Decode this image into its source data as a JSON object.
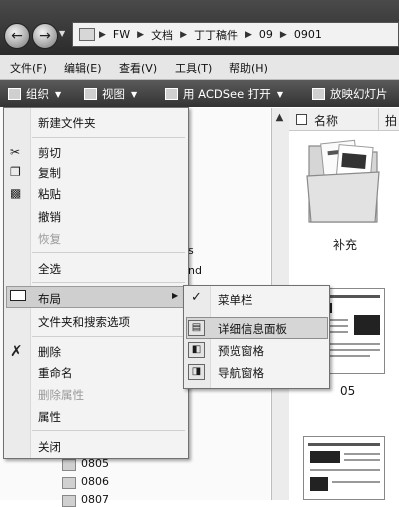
{
  "address": {
    "crumbs": [
      "FW",
      "文档",
      "丁丁稿件",
      "09",
      "0901"
    ]
  },
  "menubar": {
    "items": [
      "文件(F)",
      "编辑(E)",
      "查看(V)",
      "工具(T)",
      "帮助(H)"
    ]
  },
  "toolbar": {
    "organize": "组织",
    "view": "视图",
    "open_with": "用 ACDSee 打开",
    "slideshow": "放映幻灯片"
  },
  "context_menu": {
    "items": [
      {
        "label": "新建文件夹",
        "icon": "",
        "enabled": true
      },
      {
        "label": "剪切",
        "icon": "scissors-icon",
        "enabled": true
      },
      {
        "label": "复制",
        "icon": "copy-icon",
        "enabled": true
      },
      {
        "label": "粘贴",
        "icon": "paste-icon",
        "enabled": true
      },
      {
        "label": "撤销",
        "icon": "",
        "enabled": true
      },
      {
        "label": "恢复",
        "icon": "",
        "enabled": false
      },
      {
        "label": "全选",
        "icon": "",
        "enabled": true
      },
      {
        "label": "布局",
        "icon": "layout-icon",
        "enabled": true,
        "submenu": true,
        "highlighted": true
      },
      {
        "label": "文件夹和搜索选项",
        "icon": "",
        "enabled": true
      },
      {
        "label": "删除",
        "icon": "delete-x-icon",
        "enabled": true
      },
      {
        "label": "重命名",
        "icon": "",
        "enabled": true
      },
      {
        "label": "删除属性",
        "icon": "",
        "enabled": false
      },
      {
        "label": "属性",
        "icon": "",
        "enabled": true
      },
      {
        "label": "关闭",
        "icon": "",
        "enabled": true
      }
    ]
  },
  "submenu": {
    "items": [
      {
        "label": "菜单栏",
        "checked": true
      },
      {
        "label": "详细信息面板",
        "highlighted": true
      },
      {
        "label": "预览窗格"
      },
      {
        "label": "导航窗格"
      }
    ]
  },
  "navpane": {
    "partial_1": "s",
    "partial_2": "nd",
    "folders": [
      "0805",
      "0806",
      "0807"
    ]
  },
  "rightpane": {
    "col_name": "名称",
    "col_partial": "拍",
    "folder_label": "补充",
    "thumb_label": "05"
  }
}
